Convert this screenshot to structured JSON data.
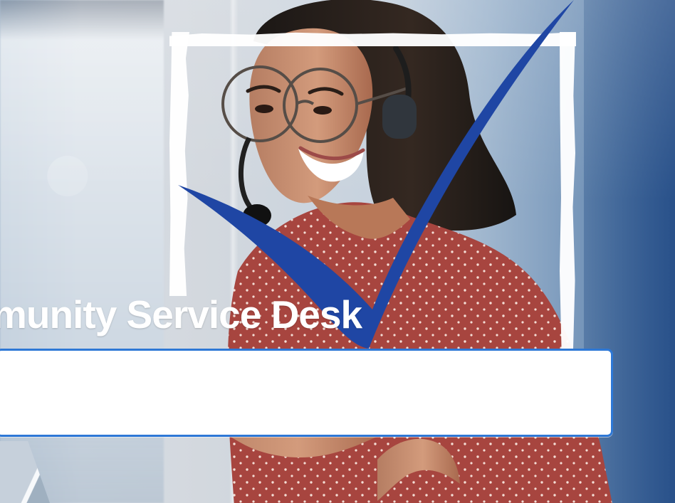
{
  "hero": {
    "title": "munity Service Desk"
  },
  "search": {
    "value": "",
    "placeholder": ""
  },
  "colors": {
    "accent_blue": "#1f46a4",
    "input_border": "#2e78d6",
    "shirt_red": "#a64a45",
    "frame_white": "#ffffff"
  },
  "icons": {
    "checkmark": "checkmark-icon",
    "headset": "headset-icon"
  }
}
